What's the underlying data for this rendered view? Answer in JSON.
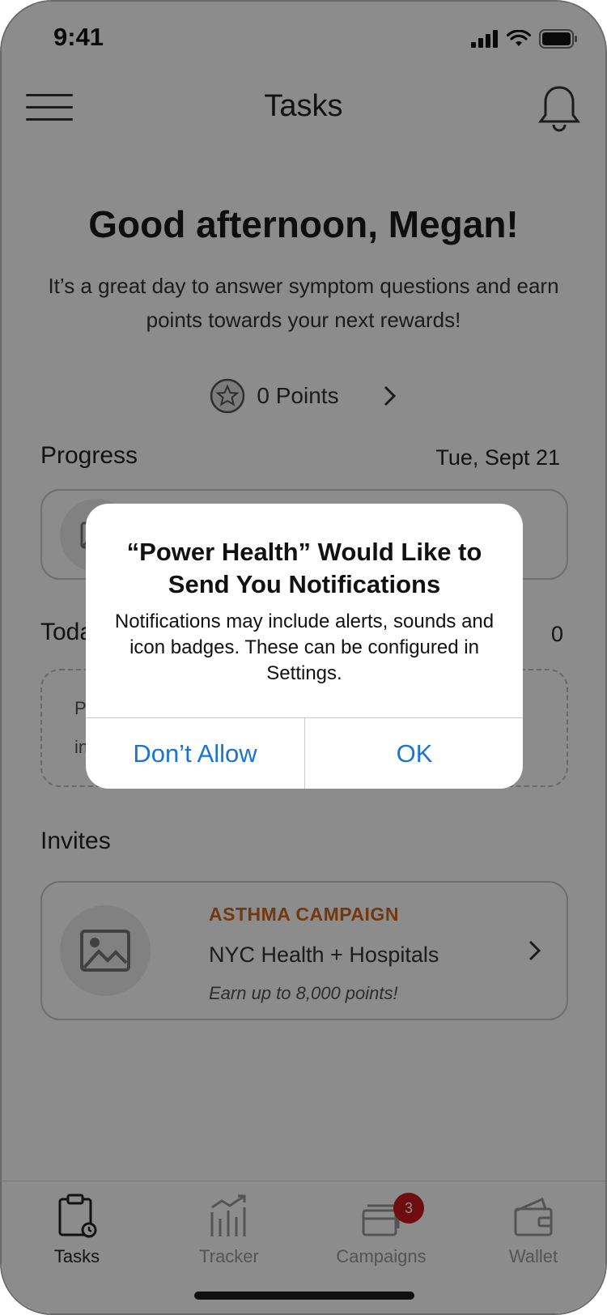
{
  "status_bar": {
    "time": "9:41"
  },
  "header": {
    "title": "Tasks"
  },
  "greeting": {
    "title": "Good afternoon, Megan!",
    "subtitle": "It’s a great day to answer symptom questions and earn points towards your next rewards!"
  },
  "points": {
    "label": "0 Points"
  },
  "progress": {
    "title": "Progress",
    "date": "Tue, Sept 21"
  },
  "today": {
    "title_partial": "Toda",
    "count": "0",
    "text_line1_partial": "P",
    "text_line2_partial": "in"
  },
  "invites": {
    "title": "Invites",
    "items": [
      {
        "tag": "ASTHMA CAMPAIGN",
        "name": "NYC Health + Hospitals",
        "subtitle": "Earn up to 8,000 points!"
      }
    ]
  },
  "tabbar": {
    "tabs": [
      {
        "label": "Tasks",
        "icon": "clipboard-clock-icon",
        "active": true
      },
      {
        "label": "Tracker",
        "icon": "chart-icon",
        "active": false
      },
      {
        "label": "Campaigns",
        "icon": "stack-icon",
        "active": false,
        "badge": "3"
      },
      {
        "label": "Wallet",
        "icon": "wallet-icon",
        "active": false
      }
    ]
  },
  "alert": {
    "title": "“Power Health” Would Like to Send You Notifications",
    "message": "Notifications may include alerts, sounds and icon badges. These can be configured in Settings.",
    "deny_label": "Don’t Allow",
    "ok_label": "OK"
  },
  "colors": {
    "accent_link": "#1a73d9",
    "campaign_tag": "#d0661d",
    "badge": "#c8161d"
  }
}
